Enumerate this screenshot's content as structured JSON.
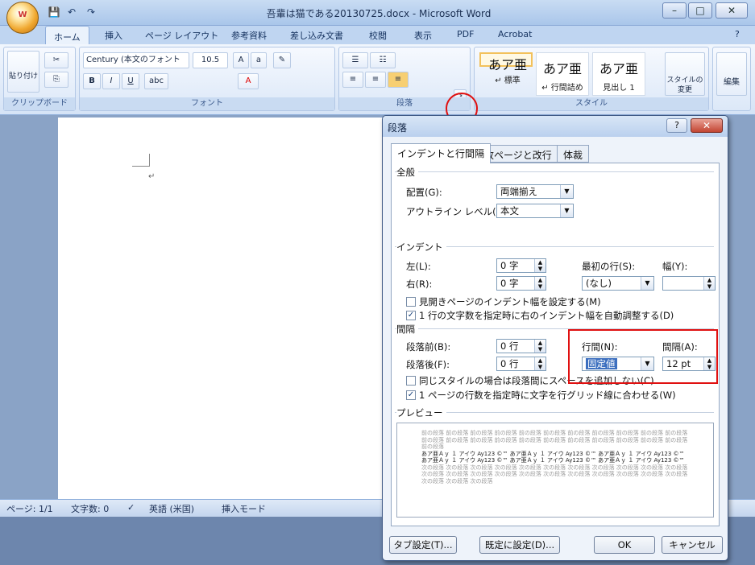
{
  "window": {
    "title": "吾輩は猫である20130725.docx - Microsoft Word",
    "office_button": "Office"
  },
  "qat": {
    "save": "💾",
    "undo": "↶",
    "redo": "↷"
  },
  "tabs": [
    "ホーム",
    "挿入",
    "ページ レイアウト",
    "参考資料",
    "差し込み文書",
    "校閲",
    "表示",
    "PDF",
    "Acrobat"
  ],
  "ribbon": {
    "clipboard": {
      "paste": "貼り付け",
      "label": "クリップボード"
    },
    "font": {
      "name": "Century (本文のフォント",
      "size": "10.5",
      "label": "フォント"
    },
    "paragraph": {
      "label": "段落"
    },
    "styles": {
      "items": [
        {
          "preview": "あア亜",
          "name": "↵ 標準"
        },
        {
          "preview": "あア亜",
          "name": "↵ 行間詰め"
        },
        {
          "preview": "あア亜",
          "name": "見出し 1"
        }
      ],
      "change": "スタイルの変更",
      "label": "スタイル"
    },
    "edit": {
      "label": "編集"
    }
  },
  "status": {
    "page": "ページ: 1/1",
    "words": "文字数: 0",
    "lang": "英語 (米国)",
    "mode": "挿入モード"
  },
  "dialog": {
    "title": "段落",
    "tabs": [
      "インデントと行間隔",
      "改ページと改行",
      "体裁"
    ],
    "general": {
      "section": "全般",
      "align_label": "配置(G):",
      "align_value": "両端揃え",
      "outline_label": "アウトライン レベル(O):",
      "outline_value": "本文"
    },
    "indent": {
      "section": "インデント",
      "left_label": "左(L):",
      "left_value": "0 字",
      "right_label": "右(R):",
      "right_value": "0 字",
      "first_label": "最初の行(S):",
      "first_value": "(なし)",
      "width_label": "幅(Y):",
      "mirror": "見開きページのインデント幅を設定する(M)",
      "auto": "1 行の文字数を指定時に右のインデント幅を自動調整する(D)"
    },
    "spacing": {
      "section": "間隔",
      "before_label": "段落前(B):",
      "before_value": "0 行",
      "after_label": "段落後(F):",
      "after_value": "0 行",
      "line_label": "行間(N):",
      "line_value": "固定値",
      "at_label": "間隔(A):",
      "at_value": "12 pt",
      "nospace": "同じスタイルの場合は段落間にスペースを追加しない(C)",
      "grid": "1 ページの行数を指定時に文字を行グリッド線に合わせる(W)"
    },
    "preview": {
      "section": "プレビュー",
      "before_text": "前の段落 前の段落 前の段落 前の段落 前の段落 前の段落 前の段落 前の段落 前の段落 前の段落 前の段落 前の段落 前の段落 前の段落 前の段落 前の段落 前の段落 前の段落 前の段落 前の段落 前の段落 前の段落 前の段落",
      "current_text": "あア亜Ａｙ １ アイウ Ay123 ©™ あア亜Ａｙ １ アイウ Ay123 ©™ あア亜Ａｙ １ アイウ Ay123 ©™ あア亜Ａｙ １ アイウ Ay123 ©™ あア亜Ａｙ １ アイウ Ay123 ©™ あア亜Ａｙ １ アイウ Ay123 ©™",
      "after_text": "次の段落 次の段落 次の段落 次の段落 次の段落 次の段落 次の段落 次の段落 次の段落 次の段落 次の段落 次の段落 次の段落 次の段落 次の段落 次の段落 次の段落 次の段落 次の段落 次の段落 次の段落 次の段落 次の段落 次の段落 次の段落"
    },
    "buttons": {
      "tabs": "タブ設定(T)...",
      "default": "既定に設定(D)...",
      "ok": "OK",
      "cancel": "キャンセル"
    }
  }
}
